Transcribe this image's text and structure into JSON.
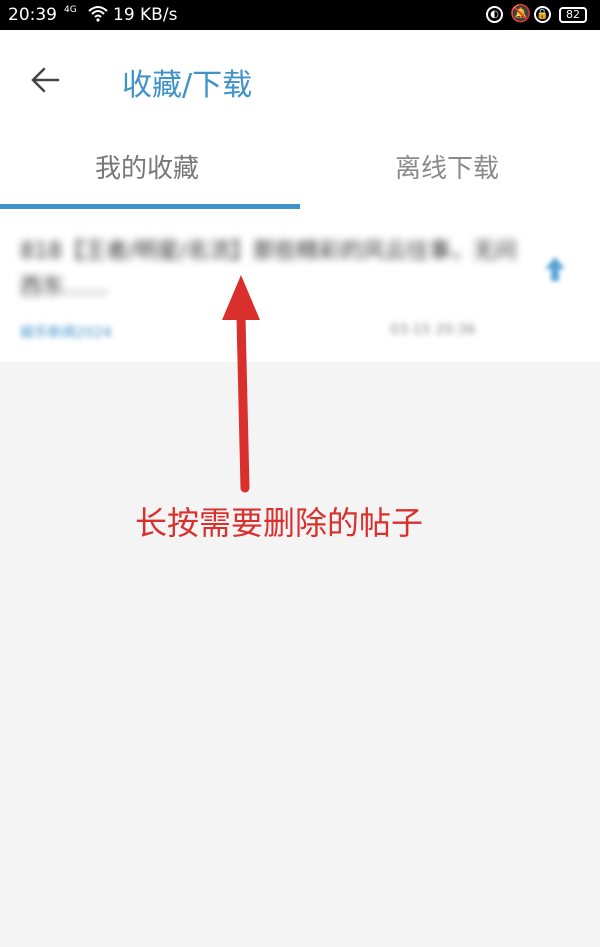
{
  "status": {
    "time": "20:39",
    "network": "4G",
    "speed": "19 KB/s",
    "battery": "82"
  },
  "header": {
    "title": "收藏/下载"
  },
  "tabs": [
    {
      "label": "我的收藏"
    },
    {
      "label": "离线下载"
    }
  ],
  "post": {
    "title": "818【王者/明星/名流】那些精彩的风云往事，无问西东……",
    "source": "娱乐新闻2024",
    "time": "03-15 20:36"
  },
  "annotation": {
    "text": "长按需要删除的帖子",
    "color": "#d9302e"
  },
  "colors": {
    "accent": "#3f93c9"
  }
}
